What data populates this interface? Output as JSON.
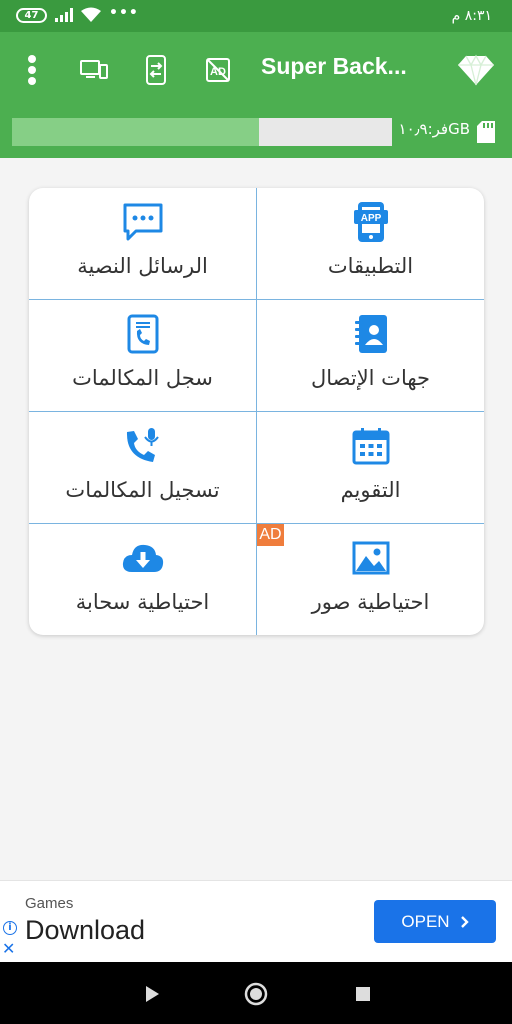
{
  "status_bar": {
    "battery": "47",
    "time": "٨:٣١ م"
  },
  "app_bar": {
    "title": "Super Back..."
  },
  "storage": {
    "text": "فر:١٠٫٩GB",
    "used_fraction": 0.65
  },
  "grid": {
    "items": [
      {
        "label": "التطبيقات",
        "icon": "apps-icon"
      },
      {
        "label": "الرسائل النصية",
        "icon": "sms-icon"
      },
      {
        "label": "جهات الإتصال",
        "icon": "contacts-icon"
      },
      {
        "label": "سجل المكالمات",
        "icon": "call-log-icon"
      },
      {
        "label": "التقويم",
        "icon": "calendar-icon"
      },
      {
        "label": "تسجيل المكالمات",
        "icon": "call-recording-icon"
      },
      {
        "label": "احتياطية صور",
        "icon": "photo-icon"
      },
      {
        "label": "احتياطية سحابة",
        "icon": "cloud-download-icon"
      }
    ],
    "ad_badge": "AD",
    "accent_color": "#1e88e5"
  },
  "ad_banner": {
    "category": "Games",
    "title": "Download",
    "button_label": "OPEN"
  },
  "colors": {
    "app_bar": "#4caf50",
    "status_bar": "#3a9a3f",
    "ad_button": "#1a73e8",
    "ad_badge": "#ef7d3c"
  }
}
